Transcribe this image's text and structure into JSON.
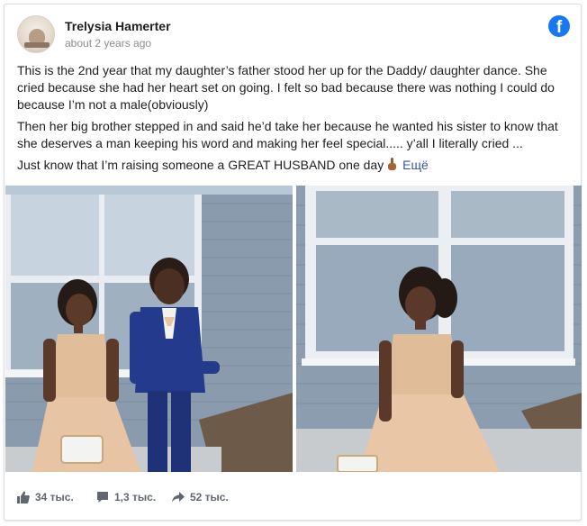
{
  "post": {
    "author": "Trelysia Hamerter",
    "timestamp": "about 2 years ago",
    "paragraphs": [
      "This is the 2nd year that my daughter’s father stood her up for the Daddy/ daughter dance. She cried because she had her heart set on going. I felt so bad because there was nothing I could do because I’m not a male(obviously)",
      "Then her big brother stepped in and said he’d take her because he wanted his sister to know that she deserves a man keeping his word and making her feel special..... y’all I literally cried ...",
      "Just know that I’m raising someone a GREAT HUSBAND one day"
    ],
    "emoji": "pointing-finger-emoji",
    "more_label": "Ещё"
  },
  "brand": {
    "logo": "facebook-logo-icon",
    "color": "#1877f2"
  },
  "stats": {
    "likes": "34 тыс.",
    "comments": "1,3 тыс.",
    "shares": "52 тыс."
  },
  "icons": {
    "like": "thumbs-up-icon",
    "comment": "comment-bubble-icon",
    "share": "share-arrow-icon"
  }
}
